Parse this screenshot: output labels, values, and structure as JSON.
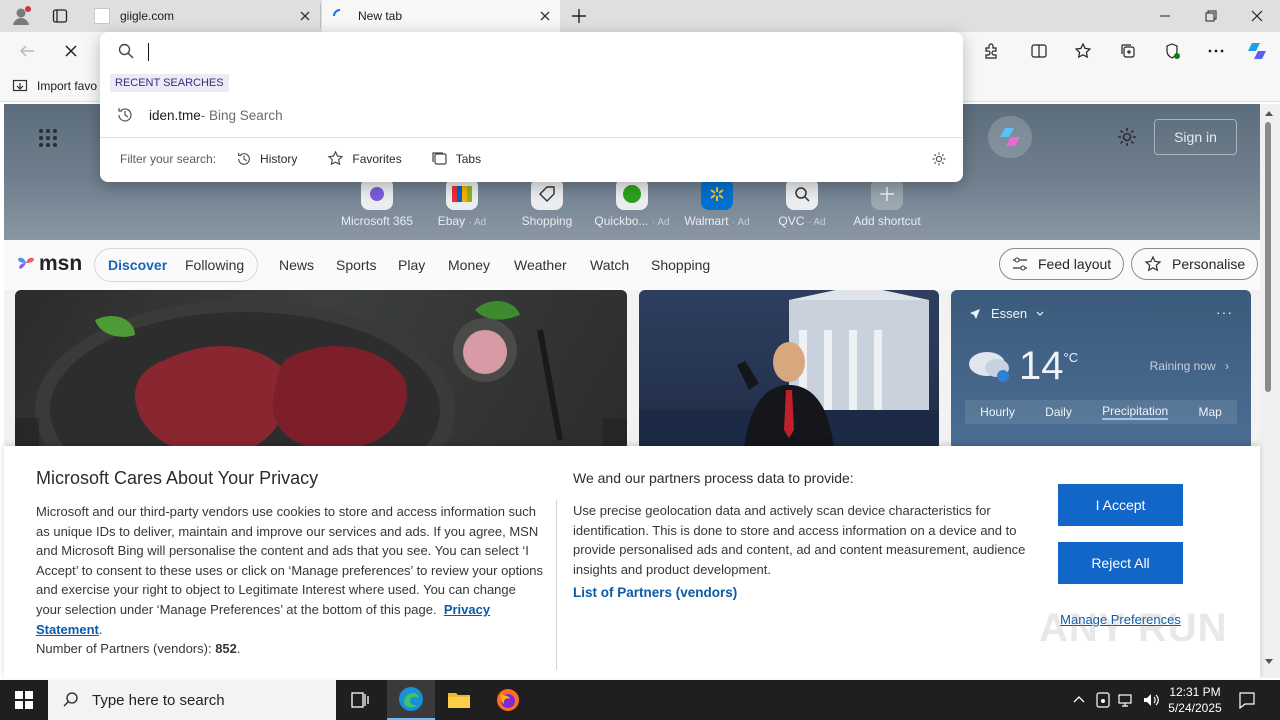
{
  "tabs": [
    {
      "title": "giigle.com"
    },
    {
      "title": "New tab"
    }
  ],
  "omnibox": {
    "value": "",
    "recent_label": "RECENT SEARCHES",
    "suggestion": {
      "text": "iden.tme",
      "sub": " - Bing Search"
    },
    "filter_label": "Filter your search:",
    "filters": [
      "History",
      "Favorites",
      "Tabs"
    ]
  },
  "favorites_bar": {
    "import_label": "Import favo"
  },
  "hero": {
    "signin_label": "Sign in",
    "shortcuts": [
      {
        "label": "Microsoft 365",
        "ad": ""
      },
      {
        "label": "Ebay",
        "ad": "· Ad"
      },
      {
        "label": "Shopping",
        "ad": ""
      },
      {
        "label": "Quickbo...",
        "ad": "· Ad"
      },
      {
        "label": "Walmart",
        "ad": "· Ad"
      },
      {
        "label": "QVC",
        "ad": "· Ad"
      },
      {
        "label": "Add shortcut",
        "ad": ""
      }
    ]
  },
  "msn": {
    "logo": "msn",
    "tabs": [
      "Discover",
      "Following"
    ],
    "nav": [
      "News",
      "Sports",
      "Play",
      "Money",
      "Weather",
      "Watch",
      "Shopping"
    ],
    "feed_layout_label": "Feed layout",
    "personalise_label": "Personalise"
  },
  "weather": {
    "location": "Essen",
    "temp": "14",
    "unit": "°C",
    "condition": "Raining now",
    "tabs": [
      "Hourly",
      "Daily",
      "Precipitation",
      "Map"
    ]
  },
  "privacy": {
    "title": "Microsoft Cares About Your Privacy",
    "body": "Microsoft and our third-party vendors use cookies to store and access information such as unique IDs to deliver, maintain and improve our services and ads. If you agree, MSN and Microsoft Bing will personalise the content and ads that you see. You can select ‘I Accept’ to consent to these uses or click on ‘Manage preferences’ to review your options and exercise your right to object to Legitimate Interest where used.  You can change your selection under ‘Manage Preferences’ at the bottom of this page.",
    "privacy_link": "Privacy Statement",
    "partners_label": "Number of Partners (vendors): ",
    "partners_count": "852",
    "right_title": "We and our partners process data to provide:",
    "right_body": "Use precise geolocation data and actively scan device characteristics for identification. This is done to store and access information on a device and to provide personalised ads and content, ad and content measurement, audience insights and product development.",
    "partners_link": "List of Partners (vendors)",
    "accept_label": "I Accept",
    "reject_label": "Reject All",
    "manage_label": "Manage Preferences"
  },
  "watermark": "ANY RUN",
  "taskbar": {
    "search_placeholder": "Type here to search",
    "time": "12:31 PM",
    "date": "5/24/2025"
  },
  "colors": {
    "accent": "#1266c7",
    "link": "#0a5aaa",
    "taskbar": "#1f1f1f"
  }
}
